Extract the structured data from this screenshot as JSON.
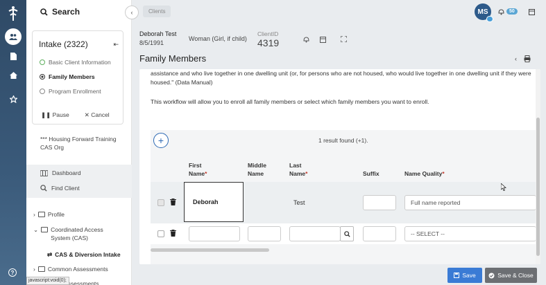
{
  "sidebar": {
    "search_label": "Search",
    "intake_title": "Intake (2322)",
    "steps": [
      {
        "label": "Basic Client Information",
        "state": "done"
      },
      {
        "label": "Family Members",
        "state": "current"
      },
      {
        "label": "Program Enrollment",
        "state": "pending"
      }
    ],
    "pause_label": "Pause",
    "cancel_label": "Cancel",
    "org_name": "*** Housing Forward Training CAS Org",
    "nav": {
      "dashboard": "Dashboard",
      "find_client": "Find Client"
    },
    "tree": {
      "profile": "Profile",
      "cas": "Coordinated Access System (CAS)",
      "cas_intake": "CAS & Diversion Intake",
      "common": "Common Assessments",
      "other": "Other Assessments"
    },
    "statusbar": "javascript:void(0);"
  },
  "topbar": {
    "breadcrumb": "Clients",
    "avatar_initials": "MS",
    "notification_count": "50"
  },
  "client": {
    "name": "Deborah Test",
    "dob": "8/5/1991",
    "gender": "Woman (Girl, if child)",
    "id_label": "ClientID",
    "id": "4319"
  },
  "panel": {
    "title": "Family Members",
    "intro_text": "assistance and who live together in one dwelling unit (or, for persons who are not housed, who would live together in one dwelling unit if they were housed.\" (Data Manual)",
    "intro_text2": "This workflow will allow you to enroll all family members or select which family members you want to enroll.",
    "result_count": "1 result found (+1).",
    "columns": {
      "first_a": "First",
      "first_b": "Name",
      "middle_a": "Middle",
      "middle_b": "Name",
      "last_a": "Last",
      "last_b": "Name",
      "suffix": "Suffix",
      "name_quality": "Name Quality"
    },
    "required_mark": "*",
    "row1": {
      "first": "Deborah",
      "last": "Test",
      "name_quality": "Full name reported"
    },
    "row2": {
      "name_quality": "-- SELECT --"
    }
  },
  "buttons": {
    "save": "Save",
    "save_close": "Save & Close"
  },
  "colors": {
    "accent": "#3a7bd5",
    "rail": "#2f4a66",
    "required": "#c0392b",
    "done_step": "#5cae5c"
  }
}
